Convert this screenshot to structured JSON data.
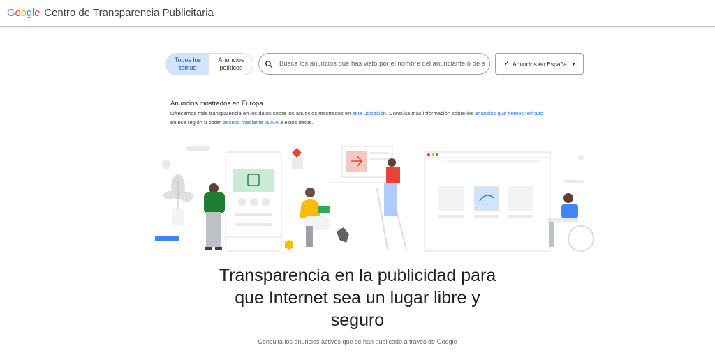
{
  "header": {
    "logo_letters": [
      {
        "ch": "G",
        "color": "#4285F4"
      },
      {
        "ch": "o",
        "color": "#EA4335"
      },
      {
        "ch": "o",
        "color": "#FBBC05"
      },
      {
        "ch": "g",
        "color": "#4285F4"
      },
      {
        "ch": "l",
        "color": "#34A853"
      },
      {
        "ch": "e",
        "color": "#EA4335"
      }
    ],
    "title": "Centro de Transparencia Publicitaria"
  },
  "topic_tabs": [
    {
      "label": "Todos los temas",
      "active": true
    },
    {
      "label": "Anuncios políticos",
      "active": false
    }
  ],
  "search": {
    "placeholder": "Busca los anuncios que has visto por el nombre del anunciante o de su ...",
    "icon": "search-icon"
  },
  "region": {
    "check_icon": "✓",
    "label": "Anuncios en España",
    "caret_icon": "▾"
  },
  "notice": {
    "title": "Anuncios mostrados en Europa",
    "text1": "Ofrecemos más transparencia en los datos sobre los anuncios mostrados en ",
    "link1": "esta ubicación",
    "text2": ". Consulta más información sobre los ",
    "link2": "anuncios que hemos retirado",
    "text3": " en esa región u obtén ",
    "link3": "acceso mediante la API",
    "text4": " a estos datos."
  },
  "hero": {
    "headline": "Transparencia en la publicidad para que Internet sea un lugar libre y seguro",
    "subline": "Consulta los anuncios activos que se han publicado a través de Google"
  },
  "colors": {
    "accent_blue": "#1a73e8",
    "active_tab_bg": "#d2e3fc",
    "green": "#1e8e3e",
    "red": "#ea4335",
    "yellow": "#fbbc04"
  }
}
